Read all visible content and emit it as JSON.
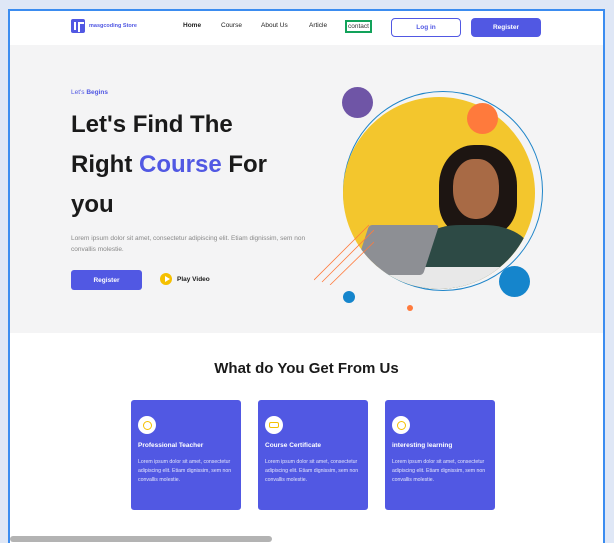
{
  "colors": {
    "brand": "#5158e3",
    "accent_yellow": "#f3c62d",
    "accent_orange": "#ff7a3c",
    "accent_blue": "#1585cc",
    "accent_purple": "#6f55a6",
    "highlight_border": "#12a25a"
  },
  "nav": {
    "logo_text": "masgcoding Store",
    "links": [
      "Home",
      "Course",
      "About Us",
      "Article",
      "contact"
    ],
    "login_label": "Log in",
    "register_label": "Register"
  },
  "hero": {
    "eyebrow_prefix": "Let's",
    "eyebrow_bold": "Begins",
    "headline_line1": "Let's Find The",
    "headline_line2_prefix": "Right",
    "headline_line2_accent": "Course",
    "headline_line2_suffix": "For",
    "headline_line3": "you",
    "subtext": "Lorem ipsum dolor sit amet, consectetur adipiscing elit. Etiam dignissim, sem non convallis molestie.",
    "register_label": "Register",
    "play_label": "Play Video"
  },
  "benefits": {
    "title": "What do You Get From Us",
    "cards": [
      {
        "icon": "user-icon",
        "title": "Professional Teacher",
        "body": "Lorem ipsum dolor sit amet, consectetur adipiscing elit. Etiam dignissim, sem non convallis molestie."
      },
      {
        "icon": "graduation-cap-icon",
        "title": "Course Certificate",
        "body": "Lorem ipsum dolor sit amet, consectetur adipiscing elit. Etiam dignissim, sem non convallis molestie."
      },
      {
        "icon": "learning-icon",
        "title": "interesting learning",
        "body": "Lorem ipsum dolor sit amet, consectetur adipiscing elit. Etiam dignissim, sem non convallis molestie."
      }
    ]
  }
}
